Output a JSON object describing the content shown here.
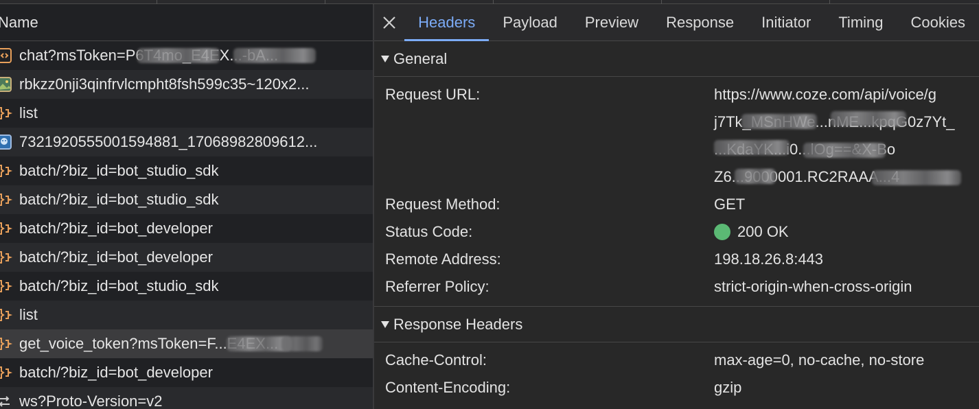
{
  "request_list": {
    "header": "Name",
    "rows": [
      {
        "icon": "document-icon",
        "label": "chat?msToken=P6T4mo_E4EX...-bA..."
      },
      {
        "icon": "image-icon",
        "label": "rbkzz0nji3qinfrvlcmpht8fsh599c35~120x2..."
      },
      {
        "icon": "fetch-icon",
        "label": "list"
      },
      {
        "icon": "avatar-image-icon",
        "label": "73219205550015948​81_17068982809612..."
      },
      {
        "icon": "fetch-icon",
        "label": "batch/?biz_id=bot_studio_sdk"
      },
      {
        "icon": "fetch-icon",
        "label": "batch/?biz_id=bot_studio_sdk"
      },
      {
        "icon": "fetch-icon",
        "label": "batch/?biz_id=bot_developer"
      },
      {
        "icon": "fetch-icon",
        "label": "batch/?biz_id=bot_developer"
      },
      {
        "icon": "fetch-icon",
        "label": "batch/?biz_id=bot_studio_sdk"
      },
      {
        "icon": "fetch-icon",
        "label": "list"
      },
      {
        "icon": "fetch-icon",
        "label": "get_voice_token?msToken=F...E4EX..."
      },
      {
        "icon": "fetch-icon",
        "label": "batch/?biz_id=bot_developer"
      },
      {
        "icon": "websocket-icon",
        "label": "ws?Proto-Version=v2"
      }
    ]
  },
  "tabs": [
    "Headers",
    "Payload",
    "Preview",
    "Response",
    "Initiator",
    "Timing",
    "Cookies"
  ],
  "active_tab": "Headers",
  "general": {
    "title": "General",
    "request_url_label": "Request URL:",
    "request_url_lines": [
      "https://www.coze.com/api/voice/g",
      "j7Tk_MSnHWe...nME...kpqG0z7Yt_",
      "...KdaYK...i0...lOg==&X-Bo",
      "Z6...9000001.RC2RAAA...4"
    ],
    "request_method_label": "Request Method:",
    "request_method": "GET",
    "status_code_label": "Status Code:",
    "status_code": "200 OK",
    "status_color": "#5bb974",
    "remote_address_label": "Remote Address:",
    "remote_address": "198.18.26.8:443",
    "referrer_policy_label": "Referrer Policy:",
    "referrer_policy": "strict-origin-when-cross-origin"
  },
  "response_headers": {
    "title": "Response Headers",
    "items": [
      {
        "name": "Cache-Control:",
        "value": "max-age=0, no-cache, no-store"
      },
      {
        "name": "Content-Encoding:",
        "value": "gzip"
      }
    ]
  },
  "colors": {
    "accent": "#7cacf8",
    "icon_orange": "#e8a05b"
  }
}
